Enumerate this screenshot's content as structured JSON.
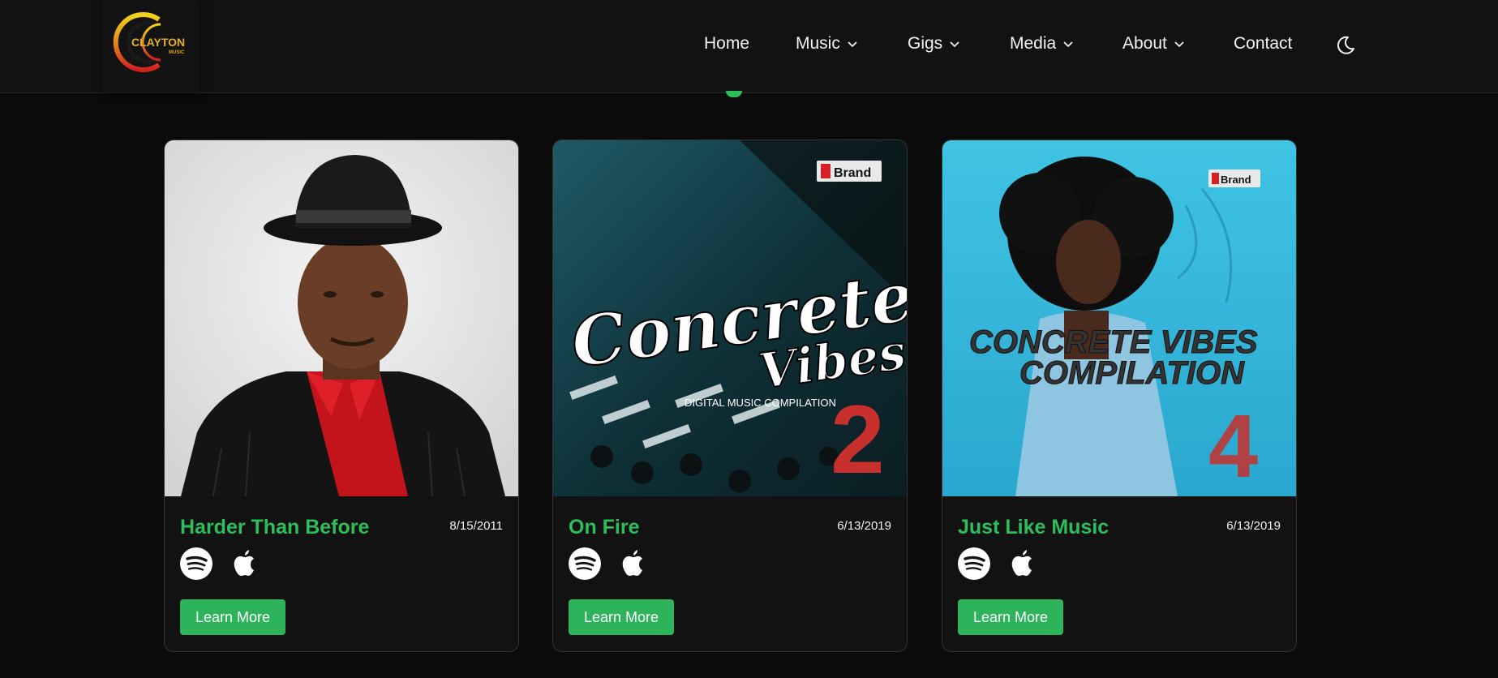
{
  "header": {
    "logo": {
      "line1": "CLAYTON",
      "line2": "MUSIC"
    },
    "nav": [
      {
        "label": "Home",
        "dropdown": false
      },
      {
        "label": "Music",
        "dropdown": true
      },
      {
        "label": "Gigs",
        "dropdown": true
      },
      {
        "label": "Media",
        "dropdown": true
      },
      {
        "label": "About",
        "dropdown": true
      },
      {
        "label": "Contact",
        "dropdown": false
      }
    ],
    "theme_toggle_icon": "moon-icon"
  },
  "colors": {
    "accent": "#2ebd5c",
    "button": "#2db35a",
    "header_bg": "#121212",
    "page_bg": "#0b0b0b"
  },
  "releases": [
    {
      "title": "Harder Than Before",
      "date": "8/15/2011",
      "cover": "portrait-man-in-hat",
      "services": [
        "spotify-icon",
        "apple-icon"
      ],
      "button": "Learn More"
    },
    {
      "title": "On Fire",
      "date": "6/13/2019",
      "cover": "concrete-vibes-2",
      "cover_text": {
        "brand": "Brand",
        "line1": "Concrete",
        "line2": "Vibes",
        "sub": "DIGITAL MUSIC COMPILATION",
        "number": "2"
      },
      "services": [
        "spotify-icon",
        "apple-icon"
      ],
      "button": "Learn More"
    },
    {
      "title": "Just Like Music",
      "date": "6/13/2019",
      "cover": "concrete-vibes-4",
      "cover_text": {
        "brand": "Brand",
        "line1": "CONCRETE VIBES",
        "line2": "COMPILATION",
        "number": "4"
      },
      "services": [
        "spotify-icon",
        "apple-icon"
      ],
      "button": "Learn More"
    }
  ]
}
